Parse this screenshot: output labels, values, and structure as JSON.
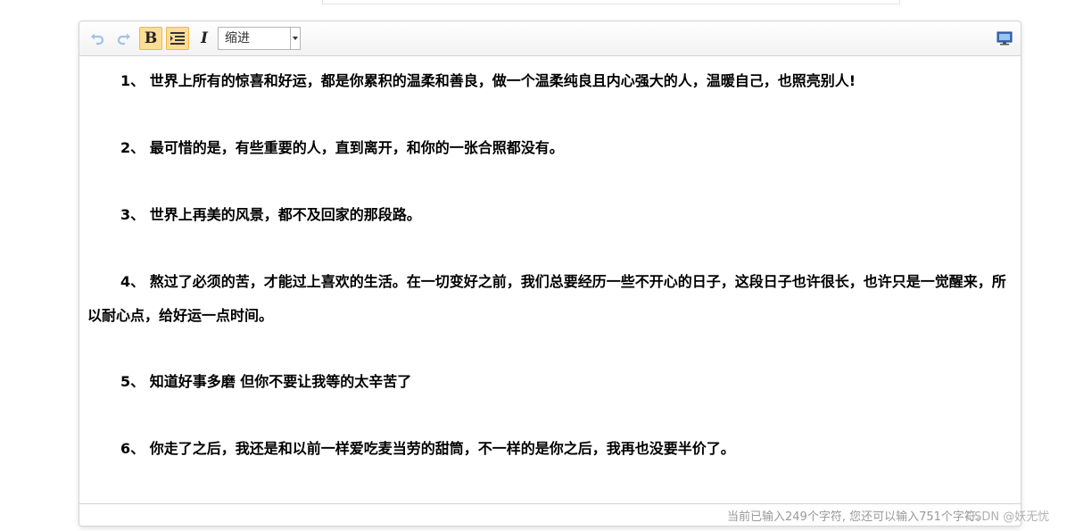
{
  "toolbar": {
    "indent_select": {
      "selected": "缩进"
    },
    "icons": {
      "undo": "undo-icon",
      "redo": "redo-icon",
      "bold": "B",
      "italic": "I",
      "indent_list": "indent-list-icon",
      "fullscreen": "fullscreen-monitor-icon"
    },
    "accent_active_bg": "#fcdd96",
    "accent_active_border": "#f2b746"
  },
  "content": {
    "paragraphs": [
      "1、 世界上所有的惊喜和好运，都是你累积的温柔和善良，做一个温柔纯良且内心强大的人，温暖自己，也照亮别人!",
      "2、 最可惜的是，有些重要的人，直到离开，和你的一张合照都没有。",
      "3、 世界上再美的风景，都不及回家的那段路。",
      "4、 熬过了必须的苦，才能过上喜欢的生活。在一切变好之前，我们总要经历一些不开心的日子，这段日子也许很长，也许只是一觉醒来，所以耐心点，给好运一点时间。",
      "5、 知道好事多磨 但你不要让我等的太辛苦了",
      "6、 你走了之后，我还是和以前一样爱吃麦当劳的甜筒，不一样的是你之后，我再也没要半价了。"
    ]
  },
  "status": {
    "count_text": "当前已输入249个字符, 您还可以输入751个字符。"
  },
  "watermark": {
    "text": "CSDN @妖无忧"
  }
}
